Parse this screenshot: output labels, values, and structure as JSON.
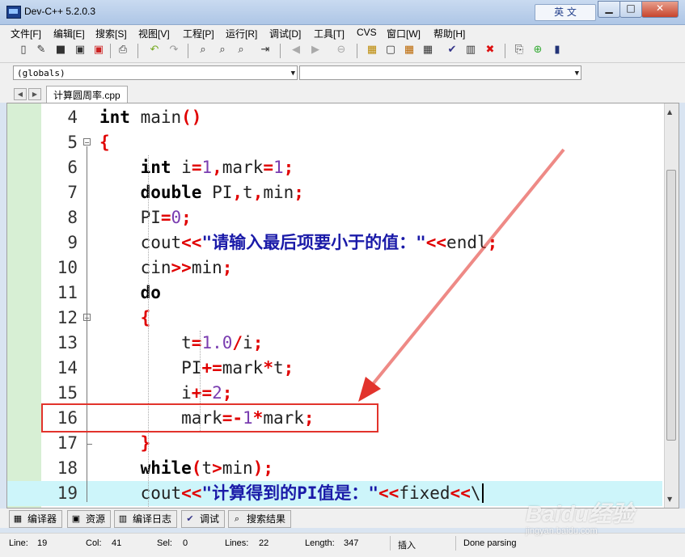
{
  "window": {
    "title": "Dev-C++ 5.2.0.3",
    "ime_label": "英 文",
    "minimize": "▁",
    "maximize": "□",
    "close": "✕"
  },
  "menu": [
    "文件[F]",
    "编辑[E]",
    "搜索[S]",
    "视图[V]",
    "工程[P]",
    "运行[R]",
    "调试[D]",
    "工具[T]",
    "CVS",
    "窗口[W]",
    "帮助[H]"
  ],
  "combos": {
    "left": "(globals)",
    "right": ""
  },
  "tab": {
    "filename": "计算圆周率.cpp"
  },
  "code": [
    {
      "n": "4",
      "text": "int main()"
    },
    {
      "n": "5",
      "text": "{"
    },
    {
      "n": "6",
      "text": "int i=1,mark=1;"
    },
    {
      "n": "7",
      "text": "double PI,t,min;"
    },
    {
      "n": "8",
      "text": "PI=0;"
    },
    {
      "n": "9",
      "text": "cout<<\"请输入最后项要小于的值：\"<<endl;"
    },
    {
      "n": "10",
      "text": "cin>>min;"
    },
    {
      "n": "11",
      "text": "do"
    },
    {
      "n": "12",
      "text": "{"
    },
    {
      "n": "13",
      "text": "t=1.0/i;"
    },
    {
      "n": "14",
      "text": "PI+=mark*t;"
    },
    {
      "n": "15",
      "text": "i+=2;"
    },
    {
      "n": "16",
      "text": "mark=-1*mark;"
    },
    {
      "n": "17",
      "text": "}"
    },
    {
      "n": "18",
      "text": "while(t>min);"
    },
    {
      "n": "19",
      "text": "cout<<\"计算得到的PI值是：\"<<fixed<<\\"
    }
  ],
  "highlighted_line": "19",
  "boxed_line": "16",
  "bottom_tabs": [
    "编译器",
    "资源",
    "编译日志",
    "调试",
    "搜索结果"
  ],
  "status": {
    "line_label": "Line:",
    "line_value": "19",
    "col_label": "Col:",
    "col_value": "41",
    "sel_label": "Sel:",
    "sel_value": "0",
    "lines_label": "Lines:",
    "lines_value": "22",
    "length_label": "Length:",
    "length_value": "347",
    "mode": "插入",
    "parse": "Done parsing"
  },
  "watermark": {
    "main": "Baidu经验",
    "sub": "jingyan.baidu.com"
  },
  "colors": {
    "annotation_red": "#e2332c",
    "highlight_line": "#cdf5fa",
    "left_panel": "#d7efd4"
  }
}
